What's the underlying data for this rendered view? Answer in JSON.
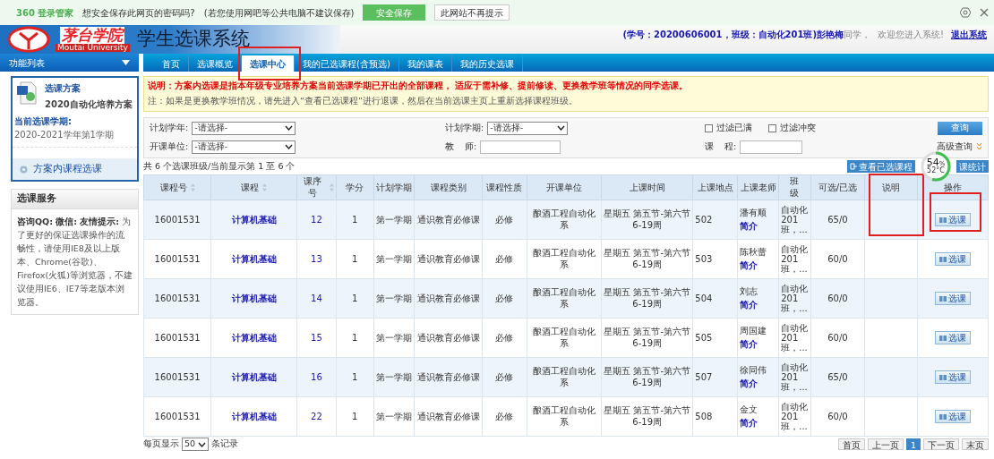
{
  "password_bar": {
    "brand": "360 登录管家",
    "question": "想安全保存此网页的密码吗?",
    "hint": "(若您使用网吧等公共电脑不建议保存)",
    "save_button": "安全保存",
    "dismiss_button": "此网站不再提示"
  },
  "header": {
    "logo_name": "茅台学院",
    "logo_english": "Moutai University",
    "title": "学生选课系统",
    "user": "**(学号：20200606001，班级：自动化201班)彭艳梅**同学，",
    "welcome": "欢迎您进入系统!",
    "logout": "退出系统"
  },
  "menu_label": "功能列表",
  "tabs": [
    {
      "label": "首页",
      "selected": false
    },
    {
      "label": "选课概览",
      "selected": false
    },
    {
      "label": "选课中心",
      "selected": true
    },
    {
      "label": "我的已选课程(含预选)",
      "selected": false
    },
    {
      "label": "我的课表",
      "selected": false
    },
    {
      "label": "我的历史选课",
      "selected": false
    }
  ],
  "sidebar": {
    "plan_title": "选课方案",
    "plan_name": "2020自动化培养方案",
    "term_label": "当前选课学期:",
    "term_value": "2020-2021学年第1学期",
    "nav_item": "方案内课程选课",
    "service_title": "选课服务",
    "service_text": "**咨询QQ:        微信: 友情提示:** 为了更好的保证选课操作的流畅性，请使用IE8及以上版本、Chrome(谷歌)、 Firefox(火狐)等浏览器，不建议使用IE6、IE7等老版本浏览器。"
  },
  "notice": {
    "main": "说明：方案内选课是指本年级专业培养方案当前选课学期已开出的全部课程， 适应于需补修、提前修读、更换教学班等情况的同学选课。",
    "note": "注：如果是更换教学班情况，请先进入“查看已选课程”进行退课，然后在当前选课主页上重新选择课程班级。"
  },
  "filters": {
    "year_label": "计划学年:",
    "year_value": "-请选择-",
    "term_label": "计划学期:",
    "term_value": "-请选择-",
    "unit_label": "开课单位:",
    "unit_value": "-请选择-",
    "teacher_label": "教    师:",
    "course_label": "课    程:",
    "checkboxes": [
      {
        "label": "过滤已满",
        "checked": false
      },
      {
        "label": "过滤冲突",
        "checked": false
      }
    ],
    "search_button": "查询",
    "advanced": "高级查询"
  },
  "summary": "共 6 个选课班级/当前显示第 1 至 6 个",
  "actions": [
    "查看已选课程",
    "课统计"
  ],
  "monitor": {
    "percent": "54",
    "unit": "%",
    "temp": "52°C",
    "level": 0.54
  },
  "table": {
    "columns": [
      {
        "label": "课程号",
        "sortable": true
      },
      {
        "label": "课程",
        "sortable": true
      },
      {
        "label": "课序号",
        "sortable": true
      },
      {
        "label": "学分",
        "sortable": false
      },
      {
        "label": "计划学期",
        "sortable": false
      },
      {
        "label": "课程类别",
        "sortable": false
      },
      {
        "label": "课程性质",
        "sortable": false
      },
      {
        "label": "开课单位",
        "sortable": false
      },
      {
        "label": "上课时间",
        "sortable": false
      },
      {
        "label": "上课地点",
        "sortable": false
      },
      {
        "label": "上课老师",
        "sortable": false
      },
      {
        "label": "班级",
        "sortable": false
      },
      {
        "label": "可选/已选",
        "sortable": false
      },
      {
        "label": "说明",
        "sortable": false
      },
      {
        "label": "操作",
        "sortable": false
      }
    ],
    "rows": [
      {
        "code": "16001531",
        "course": "计算机基础",
        "seq": "12",
        "credit": "1",
        "term": "第一学期",
        "category": "通识教育必修课",
        "nature": "必修",
        "unit": "酿酒工程自动化系",
        "time": "星期五 第五节-第六节 6-19周",
        "place": "502",
        "teacher": "潘有顺",
        "intro": "简介",
        "klass": "自动化201班，...",
        "capacity": "65/0",
        "action": "选课"
      },
      {
        "code": "16001531",
        "course": "计算机基础",
        "seq": "13",
        "credit": "1",
        "term": "第一学期",
        "category": "通识教育必修课",
        "nature": "必修",
        "unit": "酿酒工程自动化系",
        "time": "星期五 第五节-第六节 6-19周",
        "place": "503",
        "teacher": "陈秋蕾",
        "intro": "简介",
        "klass": "自动化201班，...",
        "capacity": "60/0",
        "action": "选课"
      },
      {
        "code": "16001531",
        "course": "计算机基础",
        "seq": "14",
        "credit": "1",
        "term": "第一学期",
        "category": "通识教育必修课",
        "nature": "必修",
        "unit": "酿酒工程自动化系",
        "time": "星期五 第五节-第六节 6-19周",
        "place": "504",
        "teacher": "刘志",
        "intro": "简介",
        "klass": "自动化201班，...",
        "capacity": "60/0",
        "action": "选课"
      },
      {
        "code": "16001531",
        "course": "计算机基础",
        "seq": "15",
        "credit": "1",
        "term": "第一学期",
        "category": "通识教育必修课",
        "nature": "必修",
        "unit": "酿酒工程自动化系",
        "time": "星期五 第五节-第六节 6-19周",
        "place": "505",
        "teacher": "周国建",
        "intro": "简介",
        "klass": "自动化201班，...",
        "capacity": "60/0",
        "action": "选课"
      },
      {
        "code": "16001531",
        "course": "计算机基础",
        "seq": "16",
        "credit": "1",
        "term": "第一学期",
        "category": "通识教育必修课",
        "nature": "必修",
        "unit": "酿酒工程自动化系",
        "time": "星期五 第五节-第六节 6-19周",
        "place": "507",
        "teacher": "徐同伟",
        "intro": "简介",
        "klass": "自动化201班，...",
        "capacity": "65/0",
        "action": "选课"
      },
      {
        "code": "16001531",
        "course": "计算机基础",
        "seq": "22",
        "credit": "1",
        "term": "第一学期",
        "category": "通识教育必修课",
        "nature": "必修",
        "unit": "酿酒工程自动化系",
        "time": "星期五 第五节-第六节 6-19周",
        "place": "508",
        "teacher": "金文",
        "intro": "简介",
        "klass": "自动化201班，...",
        "capacity": "60/0",
        "action": "选课"
      }
    ]
  },
  "footer": {
    "per_page_label": "每页显示",
    "per_page": "50",
    "per_page_suffix": "条记录",
    "pager": [
      {
        "label": "首页",
        "selected": false
      },
      {
        "label": "上一页",
        "selected": false
      },
      {
        "label": "1",
        "selected": true
      },
      {
        "label": "下一页",
        "selected": false
      },
      {
        "label": "末页",
        "selected": false
      }
    ]
  }
}
